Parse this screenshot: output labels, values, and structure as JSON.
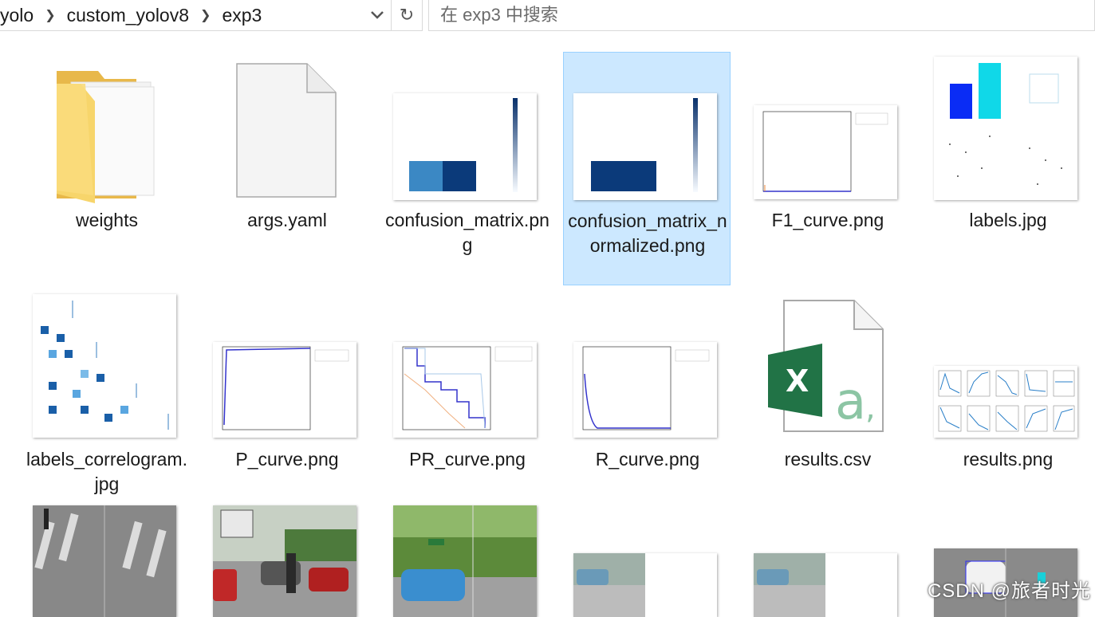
{
  "breadcrumb": [
    "yolo",
    "custom_yolov8",
    "exp3"
  ],
  "search": {
    "placeholder": "在 exp3 中搜索"
  },
  "items": [
    {
      "name": "weights"
    },
    {
      "name": "args.yaml"
    },
    {
      "name": "confusion_matrix.png"
    },
    {
      "name": "confusion_matrix_normalized.png"
    },
    {
      "name": "F1_curve.png"
    },
    {
      "name": "labels.jpg"
    },
    {
      "name": "labels_correlogram.jpg"
    },
    {
      "name": "P_curve.png"
    },
    {
      "name": "PR_curve.png"
    },
    {
      "name": "R_curve.png"
    },
    {
      "name": "results.csv"
    },
    {
      "name": "results.png"
    },
    {
      "name": "",
      "kind": "image-thumbnail"
    },
    {
      "name": "",
      "kind": "image-thumbnail"
    },
    {
      "name": "",
      "kind": "image-thumbnail"
    },
    {
      "name": "",
      "kind": "image-thumbnail"
    },
    {
      "name": "",
      "kind": "image-thumbnail"
    },
    {
      "name": "",
      "kind": "image-thumbnail"
    }
  ],
  "watermark": "CSDN @旅者时光",
  "colors": {
    "selection": "#cce8ff",
    "selection_border": "#99d1ff",
    "excel_green": "#217346",
    "folder_yellow": "#f7d56b"
  }
}
